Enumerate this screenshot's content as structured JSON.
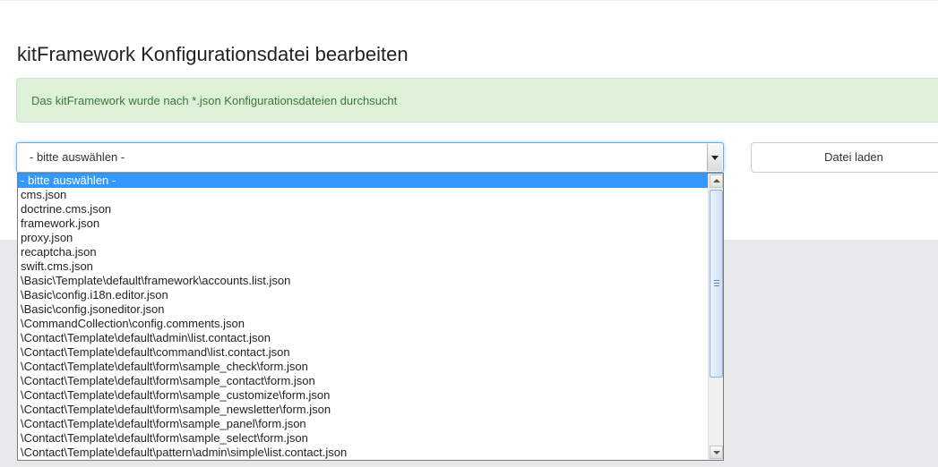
{
  "page": {
    "title": "kitFramework Konfigurationsdatei bearbeiten"
  },
  "alert": {
    "message": "Das kitFramework wurde nach *.json Konfigurationsdateien durchsucht"
  },
  "file_select": {
    "selected": "- bitte auswählen -",
    "options": [
      "- bitte auswählen -",
      "cms.json",
      "doctrine.cms.json",
      "framework.json",
      "proxy.json",
      "recaptcha.json",
      "swift.cms.json",
      "\\Basic\\Template\\default\\framework\\accounts.list.json",
      "\\Basic\\config.i18n.editor.json",
      "\\Basic\\config.jsoneditor.json",
      "\\CommandCollection\\config.comments.json",
      "\\Contact\\Template\\default\\admin\\list.contact.json",
      "\\Contact\\Template\\default\\command\\list.contact.json",
      "\\Contact\\Template\\default\\form\\sample_check\\form.json",
      "\\Contact\\Template\\default\\form\\sample_contact\\form.json",
      "\\Contact\\Template\\default\\form\\sample_customize\\form.json",
      "\\Contact\\Template\\default\\form\\sample_newsletter\\form.json",
      "\\Contact\\Template\\default\\form\\sample_panel\\form.json",
      "\\Contact\\Template\\default\\form\\sample_select\\form.json",
      "\\Contact\\Template\\default\\pattern\\admin\\simple\\list.contact.json"
    ]
  },
  "load_button": {
    "label": "Datei laden"
  },
  "colors": {
    "alert_bg": "#dff0d8",
    "alert_text": "#3c763d",
    "selection": "#3399ff",
    "focus_border": "#66afe9"
  },
  "icons": {
    "dropdown_arrow": "chevron-down-icon",
    "scroll_up": "arrow-up-icon",
    "scroll_down": "arrow-down-icon"
  }
}
